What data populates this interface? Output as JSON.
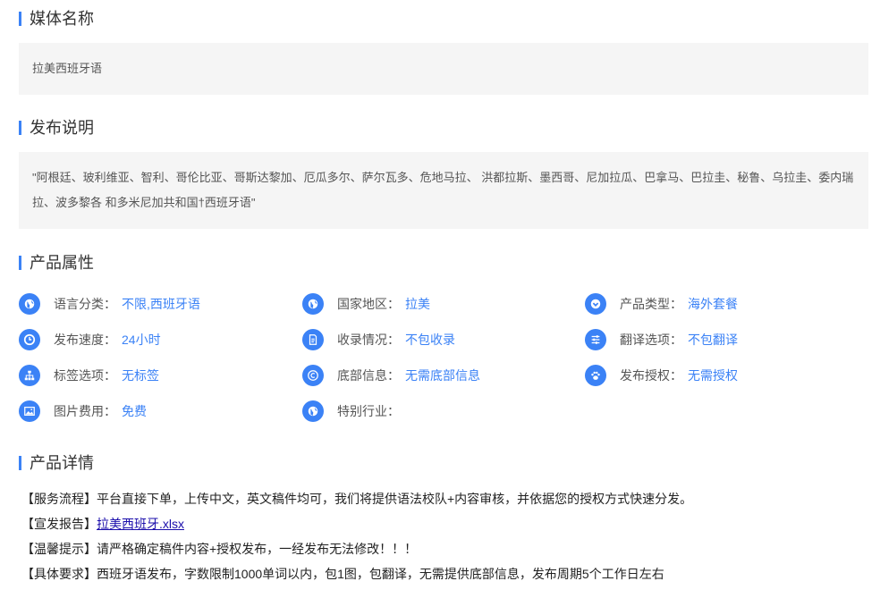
{
  "media": {
    "title": "媒体名称",
    "name": "拉美西班牙语"
  },
  "publish": {
    "title": "发布说明",
    "text": "\"阿根廷、玻利维亚、智利、哥伦比亚、哥斯达黎加、厄瓜多尔、萨尔瓦多、危地马拉、 洪都拉斯、墨西哥、尼加拉瓜、巴拿马、巴拉圭、秘鲁、乌拉圭、委内瑞拉、波多黎各 和多米尼加共和国†西班牙语\""
  },
  "attributes": {
    "title": "产品属性",
    "items": [
      {
        "label": "语言分类：",
        "value": "不限,西班牙语",
        "icon": "globe-icon"
      },
      {
        "label": "国家地区：",
        "value": "拉美",
        "icon": "globe-icon"
      },
      {
        "label": "产品类型：",
        "value": "海外套餐",
        "icon": "chevron-down-icon"
      },
      {
        "label": "发布速度：",
        "value": "24小时",
        "icon": "clock-icon"
      },
      {
        "label": "收录情况：",
        "value": "不包收录",
        "icon": "document-icon"
      },
      {
        "label": "翻译选项：",
        "value": "不包翻译",
        "icon": "sliders-icon"
      },
      {
        "label": "标签选项：",
        "value": "无标签",
        "icon": "sitemap-icon"
      },
      {
        "label": "底部信息：",
        "value": "无需底部信息",
        "icon": "copyright-icon"
      },
      {
        "label": "发布授权：",
        "value": "无需授权",
        "icon": "paw-icon"
      },
      {
        "label": "图片费用：",
        "value": "免费",
        "icon": "image-icon"
      },
      {
        "label": "特别行业：",
        "value": "",
        "icon": "globe-icon"
      }
    ]
  },
  "details": {
    "title": "产品详情",
    "lines": [
      {
        "prefix": "【服务流程】",
        "text": "平台直接下单，上传中文，英文稿件均可，我们将提供语法校队+内容审核，并依据您的授权方式快速分发。"
      },
      {
        "prefix": "【宣发报告】",
        "link": "拉美西班牙.xlsx"
      },
      {
        "prefix": "【温馨提示】",
        "text": "请严格确定稿件内容+授权发布，一经发布无法修改！！！"
      },
      {
        "prefix": "【具体要求】",
        "text": "西班牙语发布，字数限制1000单词以内，包1图，包翻译，无需提供底部信息，发布周期5个工作日左右"
      }
    ]
  },
  "colors": {
    "accent": "#3b82f6",
    "box_bg": "#f5f5f5"
  }
}
